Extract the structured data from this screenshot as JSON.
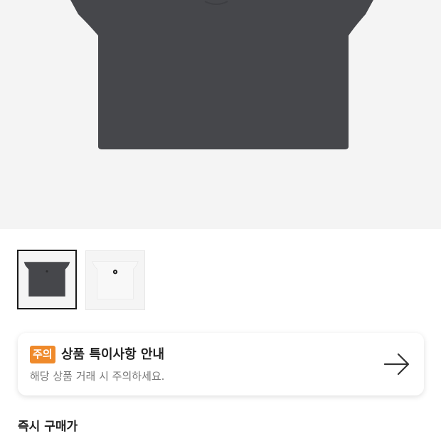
{
  "product_image": {
    "alt_color": "#46474b"
  },
  "thumbnails": [
    {
      "name": "charcoal",
      "color": "#46474b",
      "selected": true
    },
    {
      "name": "white",
      "color": "#f7f7f7",
      "selected": false
    }
  ],
  "notice": {
    "badge": "주의",
    "title": "상품 특이사항 안내",
    "subtitle": "해당 상품 거래 시 주의하세요.",
    "icon": "arrow-right-icon",
    "badge_color": "#ef8a2b"
  },
  "price_section": {
    "title": "즉시 구매가"
  }
}
